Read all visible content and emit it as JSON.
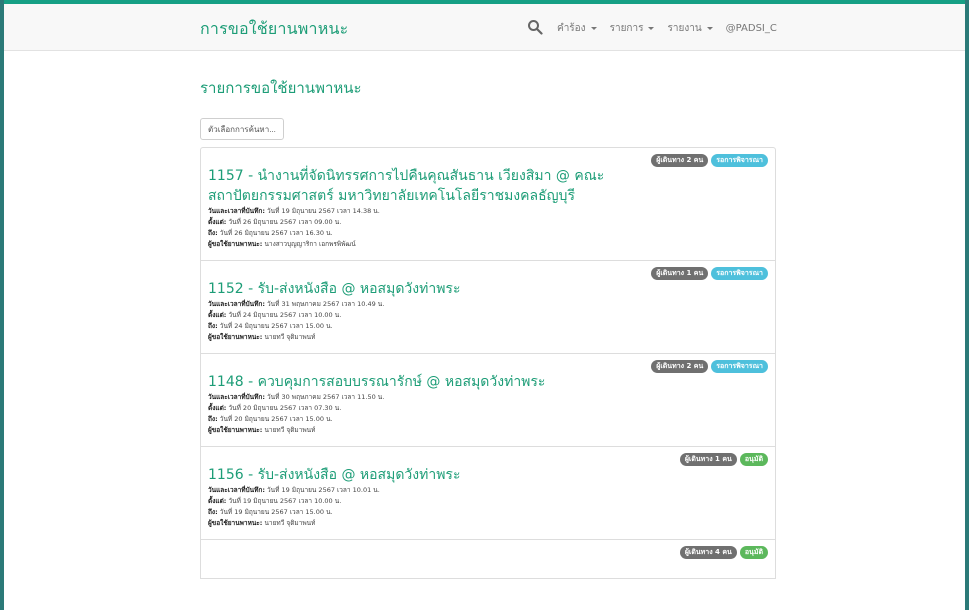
{
  "navbar": {
    "brand": "การขอใช้ยานพาหนะ",
    "menu": [
      {
        "label": "คำร้อง"
      },
      {
        "label": "รายการ"
      },
      {
        "label": "รายงาน"
      }
    ],
    "user": "@PADSI_C"
  },
  "page": {
    "title": "รายการขอใช้ยานพาหนะ",
    "filter_button": "ตัวเลือกการค้นหา..."
  },
  "labels": {
    "saved": "วันและเวลาที่บันทึก:",
    "from": "ตั้งแต่:",
    "to": "ถึง:",
    "user": "ผู้ขอใช้ยานพาหนะ:"
  },
  "requests": [
    {
      "title": "1157 - นำงานที่จัดนิทรรศการไปคืนคุณสันธาน เวียงสิมา @ คณะสถาปัตยกรรมศาสตร์ มหาวิทยาลัยเทคโนโลยีราชมงคลธัญบุรี",
      "passengers": "ผู้เดินทาง 2 คน",
      "status": "รอการพิจารณา",
      "status_color": "#4ec0dc",
      "saved": "วันที่ 19 มิถุนายน 2567 เวลา 14.38 น.",
      "from": "วันที่ 26 มิถุนายน 2567 เวลา 09.00 น.",
      "to": "วันที่ 26 มิถุนายน 2567 เวลา 16.30 น.",
      "user": "นางสาวบุญญาริกา เอกพรพิพัฒน์"
    },
    {
      "title": "1152 - รับ-ส่งหนังสือ @ หอสมุดวังท่าพระ",
      "passengers": "ผู้เดินทาง 1 คน",
      "status": "รอการพิจารณา",
      "status_color": "#4ec0dc",
      "saved": "วันที่ 31 พฤษภาคม 2567 เวลา 10.49 น.",
      "from": "วันที่ 24 มิถุนายน 2567 เวลา 10.00 น.",
      "to": "วันที่ 24 มิถุนายน 2567 เวลา 15.00 น.",
      "user": "นายทวี จุติมาพนท์"
    },
    {
      "title": "1148 - ควบคุมการสอบบรรณารักษ์ @ หอสมุดวังท่าพระ",
      "passengers": "ผู้เดินทาง 2 คน",
      "status": "รอการพิจารณา",
      "status_color": "#4ec0dc",
      "saved": "วันที่ 30 พฤษภาคม 2567 เวลา 11.50 น.",
      "from": "วันที่ 20 มิถุนายน 2567 เวลา 07.30 น.",
      "to": "วันที่ 20 มิถุนายน 2567 เวลา 15.00 น.",
      "user": "นายทวี จุติมาพนท์"
    },
    {
      "title": "1156 - รับ-ส่งหนังสือ @ หอสมุดวังท่าพระ",
      "passengers": "ผู้เดินทาง 1 คน",
      "status": "อนุมัติ",
      "status_color": "#5cb85c",
      "saved": "วันที่ 19 มิถุนายน 2567 เวลา 10.01 น.",
      "from": "วันที่ 19 มิถุนายน 2567 เวลา 10.00 น.",
      "to": "วันที่ 19 มิถุนายน 2567 เวลา 15.00 น.",
      "user": "นายทวี จุติมาพนท์"
    },
    {
      "title": "",
      "passengers": "ผู้เดินทาง 4 คน",
      "status": "อนุมัติ",
      "status_color": "#5cb85c",
      "saved": "",
      "from": "",
      "to": "",
      "user": ""
    }
  ],
  "colors": {
    "brand": "#1d9d77",
    "info": "#4ec0dc",
    "success": "#5cb85c",
    "neutral": "#707070"
  },
  "icons": {
    "search": "magnifier"
  }
}
